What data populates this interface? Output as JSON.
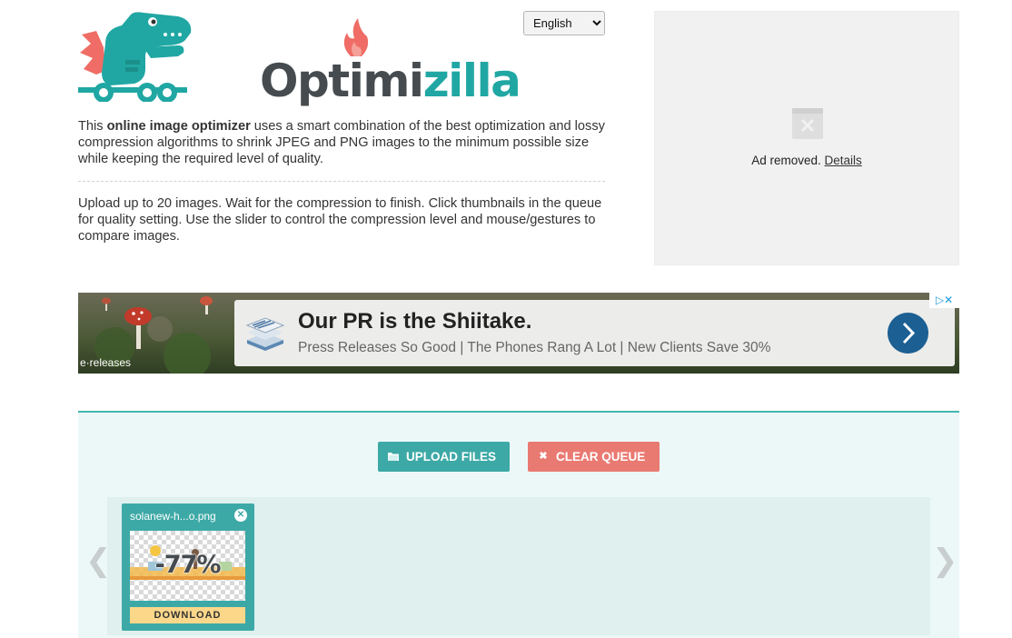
{
  "brand": {
    "logo_part1": "Optimi",
    "logo_part2": "zilla",
    "accent_color": "#3da9a6",
    "dark_color": "#454b4f"
  },
  "language": {
    "selected": "English"
  },
  "intro": {
    "p1_lead": "This ",
    "p1_strong": "online image optimizer",
    "p1_rest": " uses a smart combination of the best optimization and lossy compression algorithms to shrink JPEG and PNG images to the minimum possible size while keeping the required level of quality.",
    "p2": "Upload up to 20 images. Wait for the compression to finish. Click thumbnails in the queue for quality setting. Use the slider to control the compression level and mouse/gestures to compare images."
  },
  "side_ad": {
    "removed_text": "Ad removed.",
    "details_link": "Details"
  },
  "banner_ad": {
    "headline": "Our PR is the Shiitake.",
    "subline": "Press Releases So Good | The Phones Rang A Lot | New Clients Save 30%",
    "advertiser": "e·releases",
    "ad_choices": "▷✕",
    "button_color": "#1c5f93"
  },
  "toolbar": {
    "upload_label": "UPLOAD FILES",
    "clear_label": "CLEAR QUEUE",
    "upload_icon": "folder-icon",
    "clear_icon": "close-icon",
    "upload_color": "#3da9a6",
    "clear_color": "#e97a72"
  },
  "queue": {
    "prev_arrow": "❮",
    "next_arrow": "❯",
    "items": [
      {
        "filename": "solanew-h...o.png",
        "savings": "-77%",
        "download_label": "DOWNLOAD"
      }
    ]
  }
}
